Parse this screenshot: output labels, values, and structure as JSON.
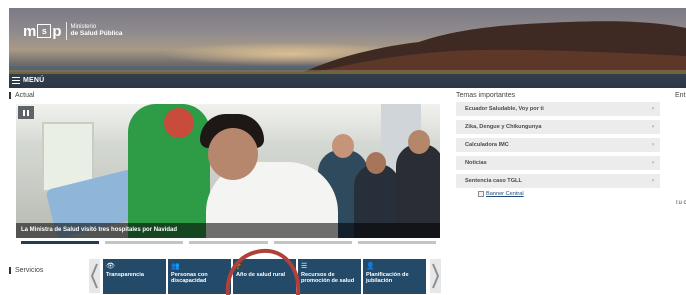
{
  "header": {
    "logo_letters": [
      "m",
      "s",
      "p"
    ],
    "logo_line1": "Ministerio",
    "logo_line2": "de Salud Pública",
    "menu_label": "MENÚ"
  },
  "actual": {
    "section_label": "Actual",
    "slide_caption": "La Ministra de Salud visitó tres hospitales por Navidad",
    "indicator_count": 5,
    "active_indicator": 1
  },
  "services": {
    "section_label": "Servicios",
    "items": [
      {
        "label": "Transparencia",
        "icon": "eye-icon",
        "glyph": "👁"
      },
      {
        "label": "Personas con discapacidad",
        "icon": "people-icon",
        "glyph": "👥"
      },
      {
        "label": "Año de salud rural",
        "icon": "graduation-cap-icon",
        "glyph": "🎓"
      },
      {
        "label": "Recursos de promoción de salud",
        "icon": "list-icon",
        "glyph": "☰"
      },
      {
        "label": "Planificación de jubilación",
        "icon": "user-icon",
        "glyph": "👤"
      }
    ],
    "prev_icon": "chevron-left-icon",
    "next_icon": "chevron-right-icon"
  },
  "topics": {
    "title": "Temas importantes",
    "items": [
      {
        "label": "Ecuador Saludable, Voy por ti",
        "chevron": "›"
      },
      {
        "label": "Zika, Dengue y Chikungunya",
        "chevron": "›"
      },
      {
        "label": "Calculadora IMC",
        "chevron": "›"
      },
      {
        "label": "Noticias",
        "chevron": "›"
      },
      {
        "label": "Sentencia caso TGLL",
        "chevron": "›"
      }
    ],
    "banner_alt": "Banner Central"
  },
  "right_column": {
    "heading_clip": "Ent",
    "text_clip": "Tu c"
  },
  "colors": {
    "service_tile": "#234a68",
    "indicator_active": "#243b55",
    "annotation_circle": "#b0413a",
    "topic_bg": "#ececec"
  }
}
